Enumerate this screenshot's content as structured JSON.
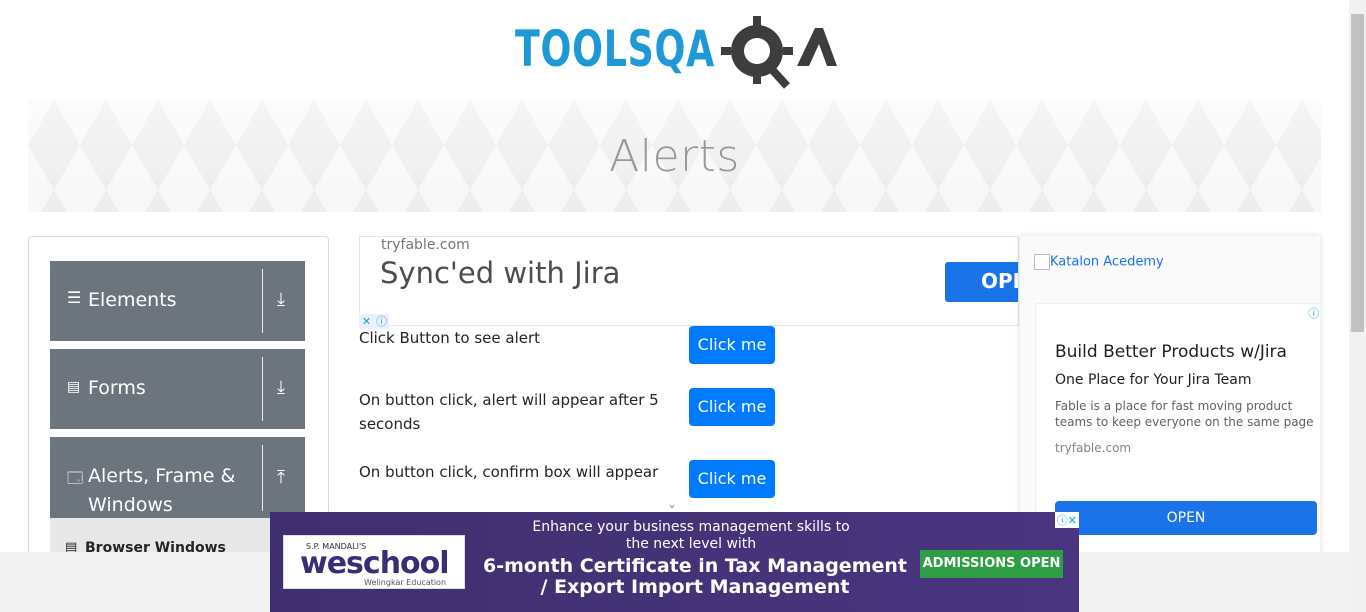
{
  "header": {
    "logo_text": "TOOLSQA"
  },
  "banner": {
    "title": "Alerts"
  },
  "sidebar": {
    "groups": [
      {
        "label": "Elements",
        "icon": "menu-icon",
        "toggle": "download-arrow-icon"
      },
      {
        "label": "Forms",
        "icon": "document-icon",
        "toggle": "download-arrow-icon"
      },
      {
        "label": "Alerts, Frame & Windows",
        "label_lines": [
          "Alerts, Frame &",
          "Windows"
        ],
        "icon": "window-icon",
        "toggle": "upload-arrow-icon"
      }
    ],
    "active_item": {
      "label": "Browser Windows",
      "icon": "document-icon"
    }
  },
  "ad_top": {
    "domain": "tryfable.com",
    "headline": "Sync'ed with Jira",
    "button": "OPEN"
  },
  "alerts": [
    {
      "label": "Click Button to see alert",
      "button": "Click me"
    },
    {
      "label": "On button click, alert will appear after 5 seconds",
      "button": "Click me"
    },
    {
      "label": "On button click, confirm box will appear",
      "button": "Click me"
    }
  ],
  "ad_right": {
    "image_alt": "Katalon Acedemy",
    "headline": "Build Better Products w/Jira",
    "subhead": "One Place for Your Jira Team",
    "description": "Fable is a place for fast moving product teams to keep everyone on the same page",
    "domain": "tryfable.com",
    "button": "OPEN"
  },
  "ad_bottom": {
    "brand_pre": "S.P. MANDALI'S",
    "brand": "weschool",
    "brand_tag": "Welingkar Education",
    "line1": "Enhance your business management skills to the next level with",
    "line2": "6-month Certificate  in Tax Management / Export Import Management",
    "cta": "ADMISSIONS OPEN"
  },
  "colors": {
    "primary": "#007bff",
    "sidebar": "#6c757d",
    "logo_blue": "#1d9ad6",
    "logo_dark": "#3d3d3d"
  }
}
